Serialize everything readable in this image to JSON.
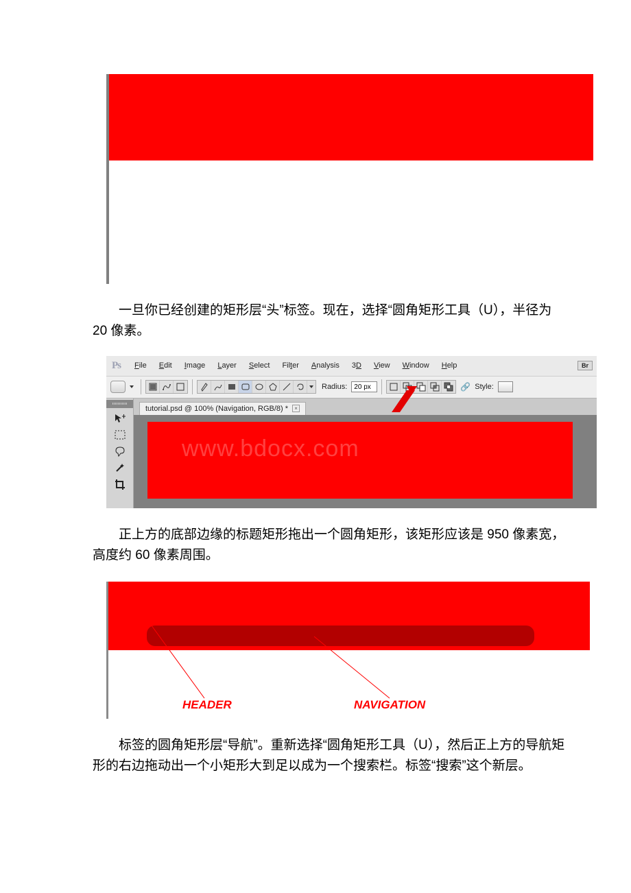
{
  "paragraphs": {
    "p1": "一旦你已经创建的矩形层“头”标签。现在，选择“圆角矩形工具（U），半径为 20 像素。",
    "p2": "正上方的底部边缘的标题矩形拖出一个圆角矩形，该矩形应该是 950 像素宽，高度约 60 像素周围。",
    "p3": "标签的圆角矩形层“导航”。重新选择“圆角矩形工具（U），然后正上方的导航矩形的右边拖动出一个小矩形大到足以成为一个搜索栏。标签“搜索”这个新层。"
  },
  "ps": {
    "logo": "Ps",
    "menu": {
      "file": {
        "u": "F",
        "rest": "ile"
      },
      "edit": {
        "u": "E",
        "rest": "dit"
      },
      "image": {
        "u": "I",
        "rest": "mage"
      },
      "layer": {
        "u": "L",
        "rest": "ayer"
      },
      "select": {
        "u": "S",
        "rest": "elect"
      },
      "filter": {
        "u": "",
        "rest": "Filter",
        "alt_u": "t"
      },
      "analysis": {
        "u": "A",
        "rest": "nalysis"
      },
      "threeD": {
        "u": "D",
        "pre": "3"
      },
      "view": {
        "u": "V",
        "rest": "iew"
      },
      "window": {
        "u": "W",
        "rest": "indow"
      },
      "help": {
        "u": "H",
        "rest": "elp"
      }
    },
    "br": "Br",
    "radius_label": "Radius:",
    "radius_value": "20 px",
    "style_label": "Style:",
    "tab_title": "tutorial.psd @ 100% (Navigation, RGB/8) *"
  },
  "figure3": {
    "header_label": "HEADER",
    "nav_label": "NAVIGATION"
  },
  "watermark": "www.bdocx.com"
}
